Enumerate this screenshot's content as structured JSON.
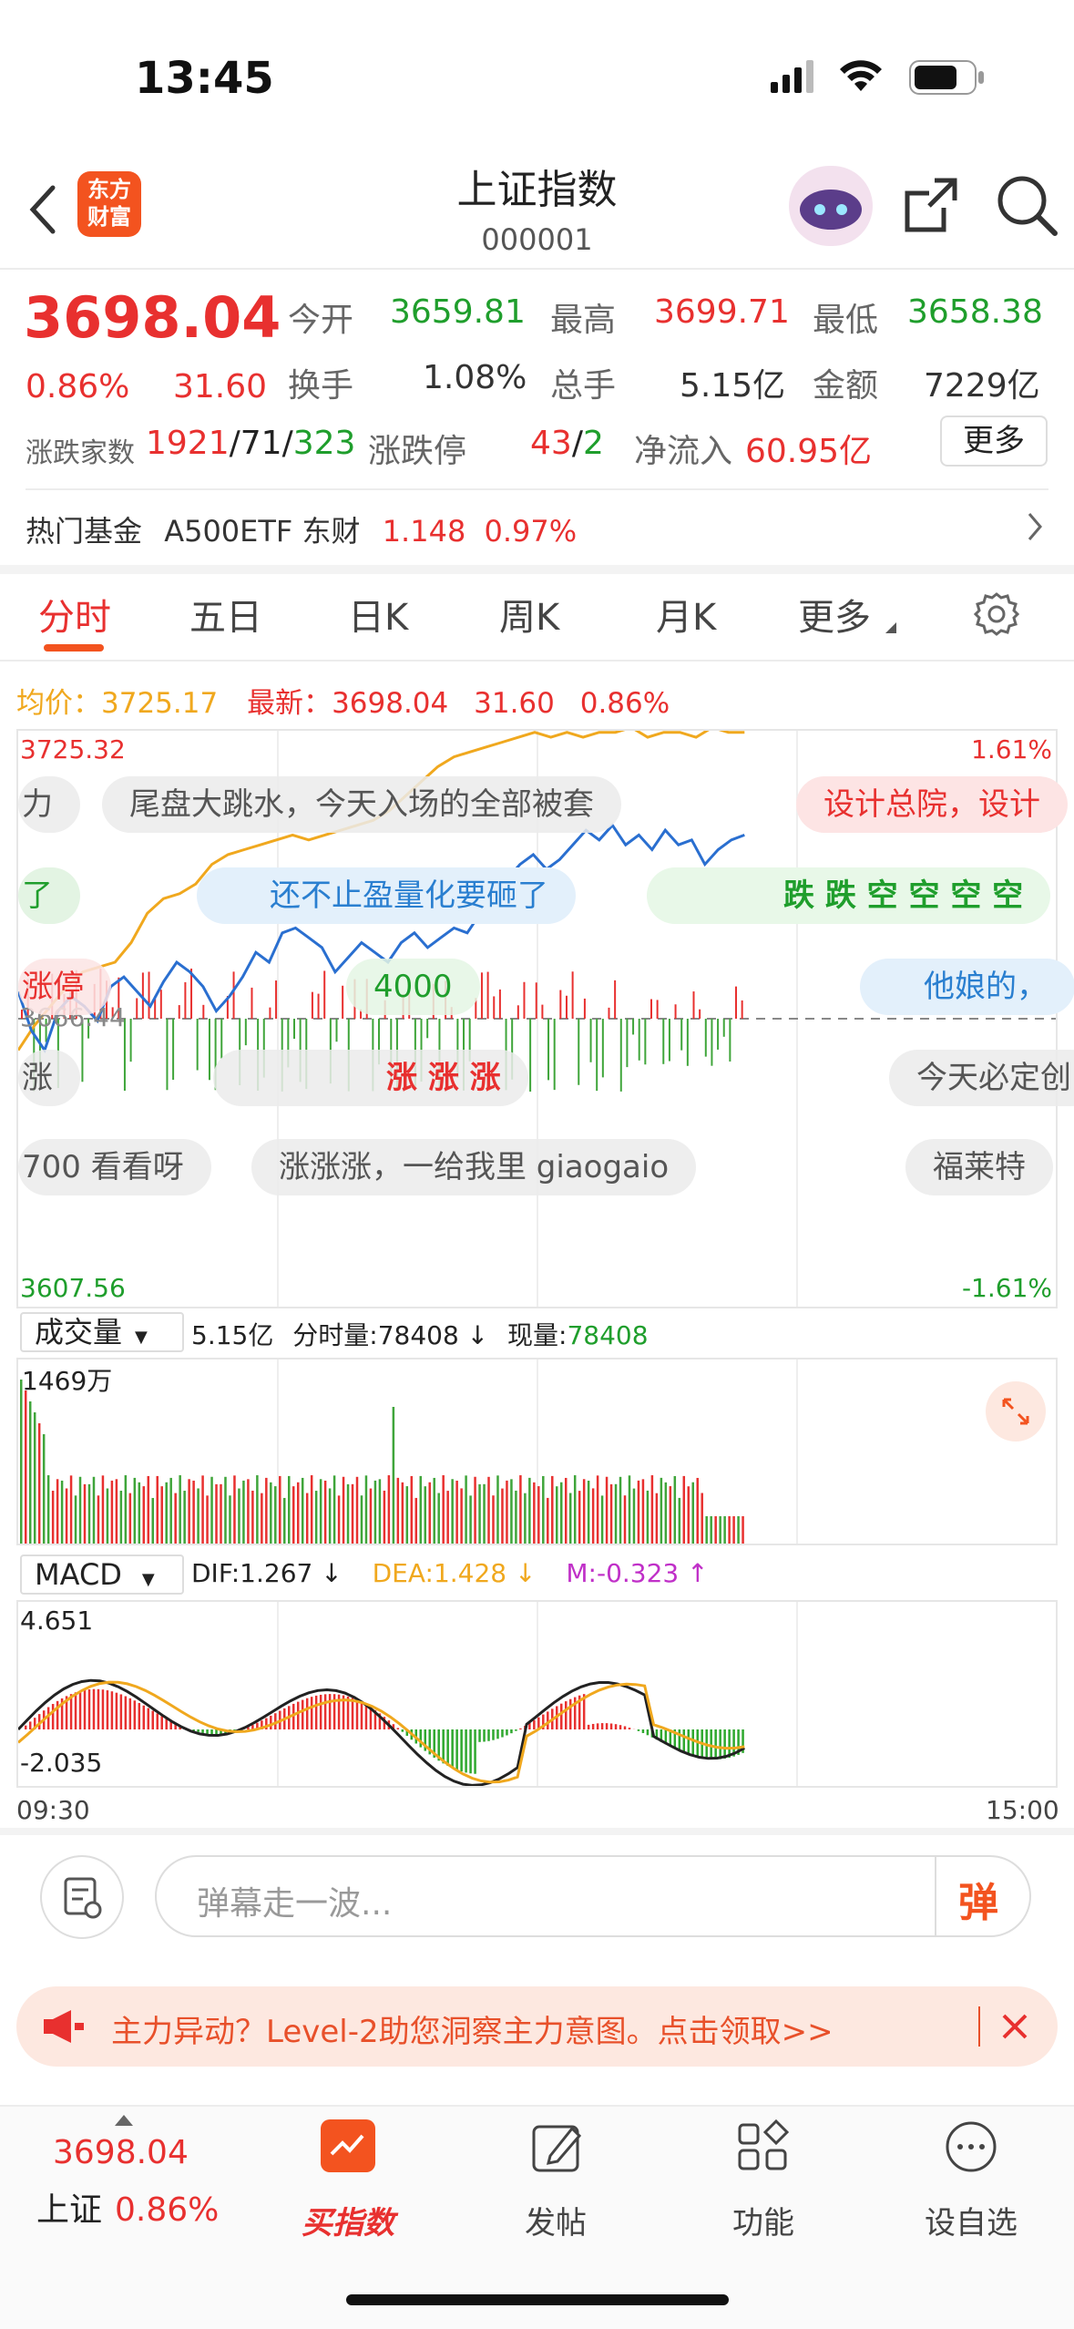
{
  "status": {
    "time": "13:45"
  },
  "header": {
    "title": "上证指数",
    "code": "000001",
    "logo_line1": "东方",
    "logo_line2": "财富"
  },
  "quote": {
    "price": "3698.04",
    "pct": "0.86%",
    "chg": "31.60",
    "open_label": "今开",
    "open": "3659.81",
    "high_label": "最高",
    "high": "3699.71",
    "low_label": "最低",
    "low": "3658.38",
    "turnover_label": "换手",
    "turnover": "1.08%",
    "volume_label": "总手",
    "volume": "5.15亿",
    "amount_label": "金额",
    "amount": "7229亿",
    "breadth_label": "涨跌家数",
    "up": "1921",
    "flat": "71",
    "down": "323",
    "limit_label": "涨跌停",
    "limit_up": "43",
    "limit_down": "2",
    "netflow_label": "净流入",
    "netflow": "60.95亿",
    "more": "更多"
  },
  "fund": {
    "label": "热门基金",
    "name": "A500ETF 东财",
    "price": "1.148",
    "pct": "0.97%"
  },
  "tabs": [
    "分时",
    "五日",
    "日K",
    "周K",
    "月K",
    "更多"
  ],
  "info": {
    "avg_label": "均价：",
    "avg": "3725.17",
    "latest_label": "最新：",
    "latest": "3698.04",
    "chg": "31.60",
    "pct": "0.86%"
  },
  "chart": {
    "ymax": "3725.32",
    "ymin": "3607.56",
    "pmax": "1.61%",
    "pmin": "-1.61%",
    "mid": "3666.44",
    "line_color": "#2a6fd0",
    "avg_color": "#f0a81e",
    "price": [
      3672,
      3664,
      3660,
      3668,
      3671,
      3669,
      3666,
      3673,
      3675,
      3672,
      3669,
      3674,
      3678,
      3676,
      3673,
      3668,
      3671,
      3675,
      3680,
      3678,
      3684,
      3685,
      3683,
      3681,
      3676,
      3679,
      3682,
      3680,
      3678,
      3682,
      3684,
      3681,
      3683,
      3685,
      3684,
      3688,
      3692,
      3695,
      3698,
      3700,
      3697,
      3699,
      3702,
      3705,
      3703,
      3706,
      3702,
      3704,
      3701,
      3705,
      3702,
      3703,
      3698,
      3701,
      3703,
      3704
    ],
    "avg": [
      3660,
      3665,
      3669,
      3673,
      3676,
      3677,
      3678,
      3682,
      3688,
      3691,
      3692,
      3694,
      3698,
      3700,
      3701,
      3702,
      3703,
      3704,
      3703,
      3704,
      3705,
      3706,
      3707,
      3709,
      3712,
      3715,
      3718,
      3720,
      3721,
      3722,
      3723,
      3724,
      3725,
      3724,
      3725,
      3724,
      3725,
      3725,
      3726,
      3724,
      3725,
      3725,
      3724,
      3726,
      3725,
      3725
    ],
    "danmu": [
      "力",
      "尾盘大跳水，今天入场的全部被套",
      "设计总院，设计",
      "了",
      "还不止盈量化要砸了",
      "跌 跌 空 空 空 空",
      "涨停",
      "4000",
      "他娘的，",
      "涨",
      "涨 涨 涨",
      "今天必定创",
      "700 看看呀",
      "涨涨涨，一给我里 giaogaio",
      "福莱特"
    ]
  },
  "volume": {
    "label": "成交量",
    "value": "5.15亿",
    "fen_label": "分时量:",
    "fen": "78408 ↓",
    "cur_label": "现量:",
    "cur": "78408",
    "max": "1469万"
  },
  "macd": {
    "label": "MACD",
    "dif": "DIF:1.267 ↓",
    "dea": "DEA:1.428 ↓",
    "m": "M:-0.323 ↑",
    "max": "4.651",
    "min": "-2.035",
    "t_start": "09:30",
    "t_end": "15:00"
  },
  "danmu_input": {
    "placeholder": "弹幕走一波...",
    "send": "弹"
  },
  "banner": {
    "text": "主力异动？Level-2助您洞察主力意图。点击领取>>"
  },
  "nav": {
    "price": "3698.04",
    "name": "上证",
    "pct": "0.86%",
    "items": [
      "买指数",
      "发帖",
      "功能",
      "设自选"
    ]
  }
}
